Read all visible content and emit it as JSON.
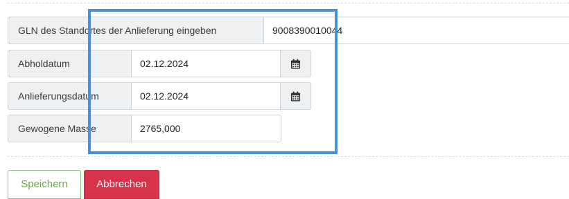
{
  "form": {
    "gln": {
      "label": "GLN des Standortes der Anlieferung eingeben",
      "value": "9008390010044"
    },
    "pickup_date": {
      "label": "Abholdatum",
      "value": "02.12.2024",
      "icon": "calendar-icon"
    },
    "delivery_date": {
      "label": "Anlieferungsdatum",
      "value": "02.12.2024",
      "icon": "calendar-icon"
    },
    "weighed_mass": {
      "label": "Gewogene Masse",
      "value": "2765,000"
    }
  },
  "buttons": {
    "save_label": "Speichern",
    "cancel_label": "Abbrechen"
  },
  "colors": {
    "highlight": "#4a8fd9",
    "save": "#6aa84f",
    "cancel": "#d9334c"
  }
}
